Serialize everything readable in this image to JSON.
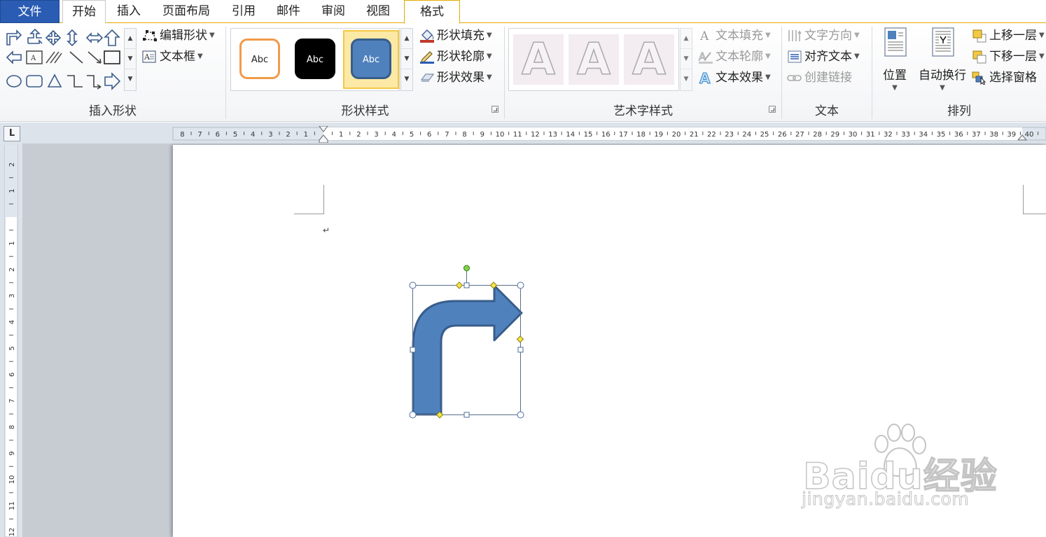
{
  "tabs": {
    "file": "文件",
    "home": "开始",
    "insert": "插入",
    "page_layout": "页面布局",
    "references": "引用",
    "mailings": "邮件",
    "review": "审阅",
    "view": "视图",
    "format": "格式"
  },
  "insert_shapes": {
    "label": "插入形状",
    "edit_shape": "编辑形状",
    "text_box": "文本框"
  },
  "shape_styles": {
    "label": "形状样式",
    "presets": [
      "Abc",
      "Abc",
      "Abc"
    ],
    "fill": "形状填充",
    "outline": "形状轮廓",
    "effects": "形状效果"
  },
  "wordart_styles": {
    "label": "艺术字样式",
    "presets": [
      "A",
      "A",
      "A"
    ],
    "text_fill": "文本填充",
    "text_outline": "文本轮廓",
    "text_effects": "文本效果"
  },
  "text_group": {
    "label": "文本",
    "direction": "文字方向",
    "align": "对齐文本",
    "create_link": "创建链接"
  },
  "arrange": {
    "label": "排列",
    "position": "位置",
    "wrap": "自动换行",
    "bring_forward": "上移一层",
    "send_backward": "下移一层",
    "selection_pane": "选择窗格"
  },
  "ruler_corner": "L",
  "paragraph_mark": "↵",
  "watermark": {
    "brand": "Baidu经验",
    "url": "jingyan.baidu.com"
  },
  "colors": {
    "file_tab": "#2a5cb3",
    "shape_fill": "#4f81bd",
    "shape_outline": "#385d8a",
    "contextual_accent": "#e6a800"
  }
}
